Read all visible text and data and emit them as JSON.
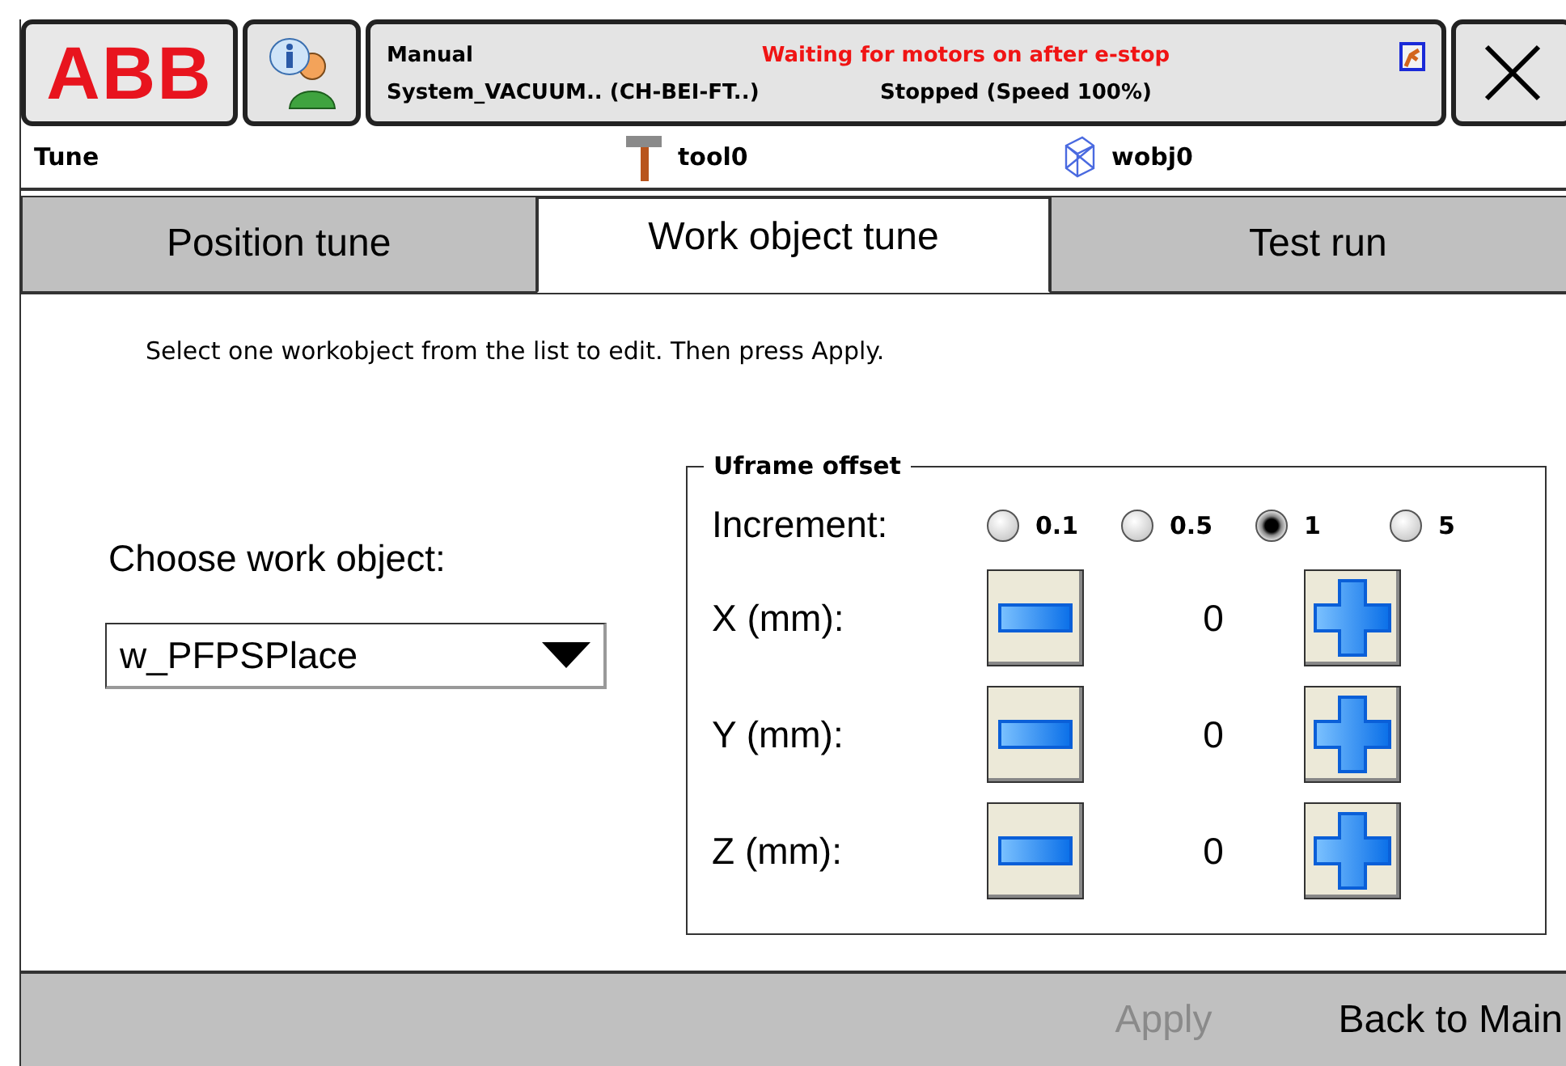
{
  "header": {
    "logo": "ABB",
    "mode": "Manual",
    "message": "Waiting for motors on after e-stop",
    "system": "System_VACUUM.. (CH-BEI-FT..)",
    "state": "Stopped (Speed 100%)"
  },
  "title_bar": {
    "title": "Tune",
    "tool": "tool0",
    "work_object": "wobj0"
  },
  "tabs": [
    {
      "label": "Position tune",
      "selected": false
    },
    {
      "label": "Work object  tune",
      "selected": true
    },
    {
      "label": "Test run",
      "selected": false
    }
  ],
  "instruction": "Select one workobject from the list to edit. Then press Apply.",
  "work_object_select": {
    "label": "Choose work object:",
    "value": "w_PFPSPlace"
  },
  "uframe_offset": {
    "legend": "Uframe offset",
    "increment_label": "Increment:",
    "increments": [
      {
        "label": "0.1",
        "selected": false
      },
      {
        "label": "0.5",
        "selected": false
      },
      {
        "label": "1",
        "selected": true
      },
      {
        "label": "5",
        "selected": false
      }
    ],
    "axes": [
      {
        "label": "X (mm):",
        "value": "0"
      },
      {
        "label": "Y (mm):",
        "value": "0"
      },
      {
        "label": "Z (mm):",
        "value": "0"
      }
    ]
  },
  "buttons": [
    {
      "label": "Apply",
      "disabled": true
    },
    {
      "label": "Back to Main",
      "disabled": false
    }
  ]
}
